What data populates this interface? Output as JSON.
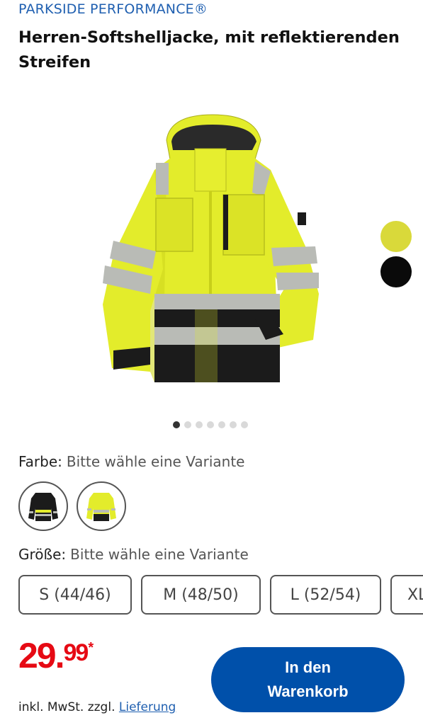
{
  "brand": "PARKSIDE PERFORMANCE®",
  "title": "Herren-Softshelljacke, mit reflektierenden Streifen",
  "image": {
    "name": "jacket-product-image"
  },
  "colors": {
    "hivis_yellow": "#e3ec2b",
    "dark": "#1b1b1b",
    "reflective": "#b9bbb6",
    "price_red": "#e60a14",
    "brand_blue": "#0050aa"
  },
  "gallery": {
    "count": 7,
    "active": 0
  },
  "color_swatches": [
    {
      "name": "yellow",
      "color": "#d9d93a"
    },
    {
      "name": "black",
      "color": "#0a0a0a"
    }
  ],
  "variant_color": {
    "label": "Farbe:",
    "hint": "Bitte wähle eine Variante"
  },
  "variant_size": {
    "label": "Größe:",
    "hint": "Bitte wähle eine Variante"
  },
  "sizes": [
    "S (44/46)",
    "M (48/50)",
    "L (52/54)",
    "XL"
  ],
  "price": {
    "main": "29.",
    "cents": "99",
    "star": "*"
  },
  "vat": {
    "text": "inkl. MwSt. zzgl.",
    "link": "Lieferung"
  },
  "cart": {
    "label": "In den Warenkorb"
  }
}
